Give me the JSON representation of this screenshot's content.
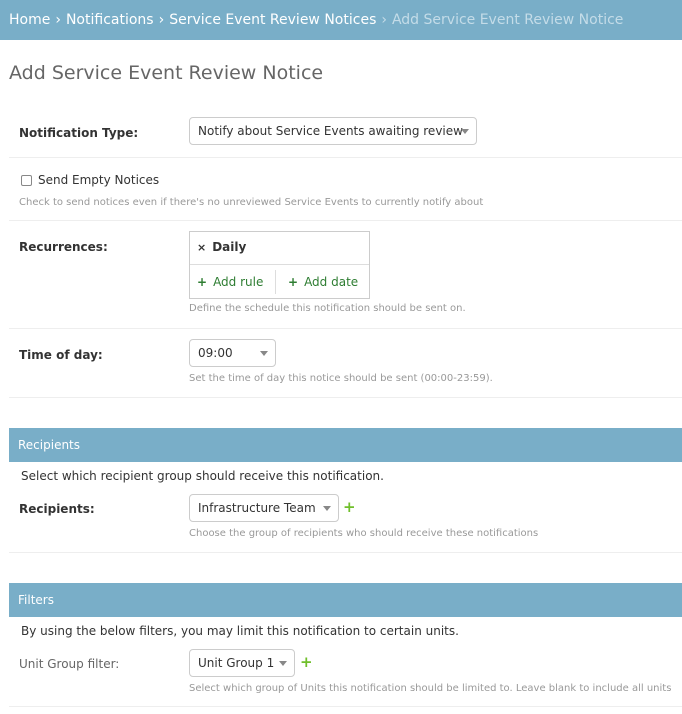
{
  "breadcrumbs": {
    "home": "Home",
    "notifications": "Notifications",
    "service_event_review_notices": "Service Event Review Notices",
    "current": "Add Service Event Review Notice",
    "separator": "›"
  },
  "page": {
    "title": "Add Service Event Review Notice"
  },
  "form": {
    "notification_type": {
      "label": "Notification Type:",
      "value": "Notify about Service Events awaiting review"
    },
    "send_empty": {
      "label": "Send Empty Notices",
      "checked": false,
      "help": "Check to send notices even if there's no unreviewed Service Events to currently notify about"
    },
    "recurrences": {
      "label": "Recurrences:",
      "item": "Daily",
      "remove_icon": "×",
      "add_rule": "Add rule",
      "add_date": "Add date",
      "plus": "+",
      "help": "Define the schedule this notification should be sent on."
    },
    "time_of_day": {
      "label": "Time of day:",
      "value": "09:00",
      "help": "Set the time of day this notice should be sent (00:00-23:59)."
    }
  },
  "recipients_section": {
    "heading": "Recipients",
    "description": "Select which recipient group should receive this notification.",
    "label": "Recipients:",
    "value": "Infrastructure Team",
    "add_icon": "+",
    "help": "Choose the group of recipients who should receive these notifications"
  },
  "filters_section": {
    "heading": "Filters",
    "description": "By using the below filters, you may limit this notification to certain units.",
    "label": "Unit Group filter:",
    "value": "Unit Group 1",
    "add_icon": "+",
    "help": "Select which group of Units this notification should be limited to. Leave blank to include all units"
  },
  "colors": {
    "header": "#79aec8",
    "add_green": "#70bf2b",
    "link_green": "#2e7d32"
  }
}
